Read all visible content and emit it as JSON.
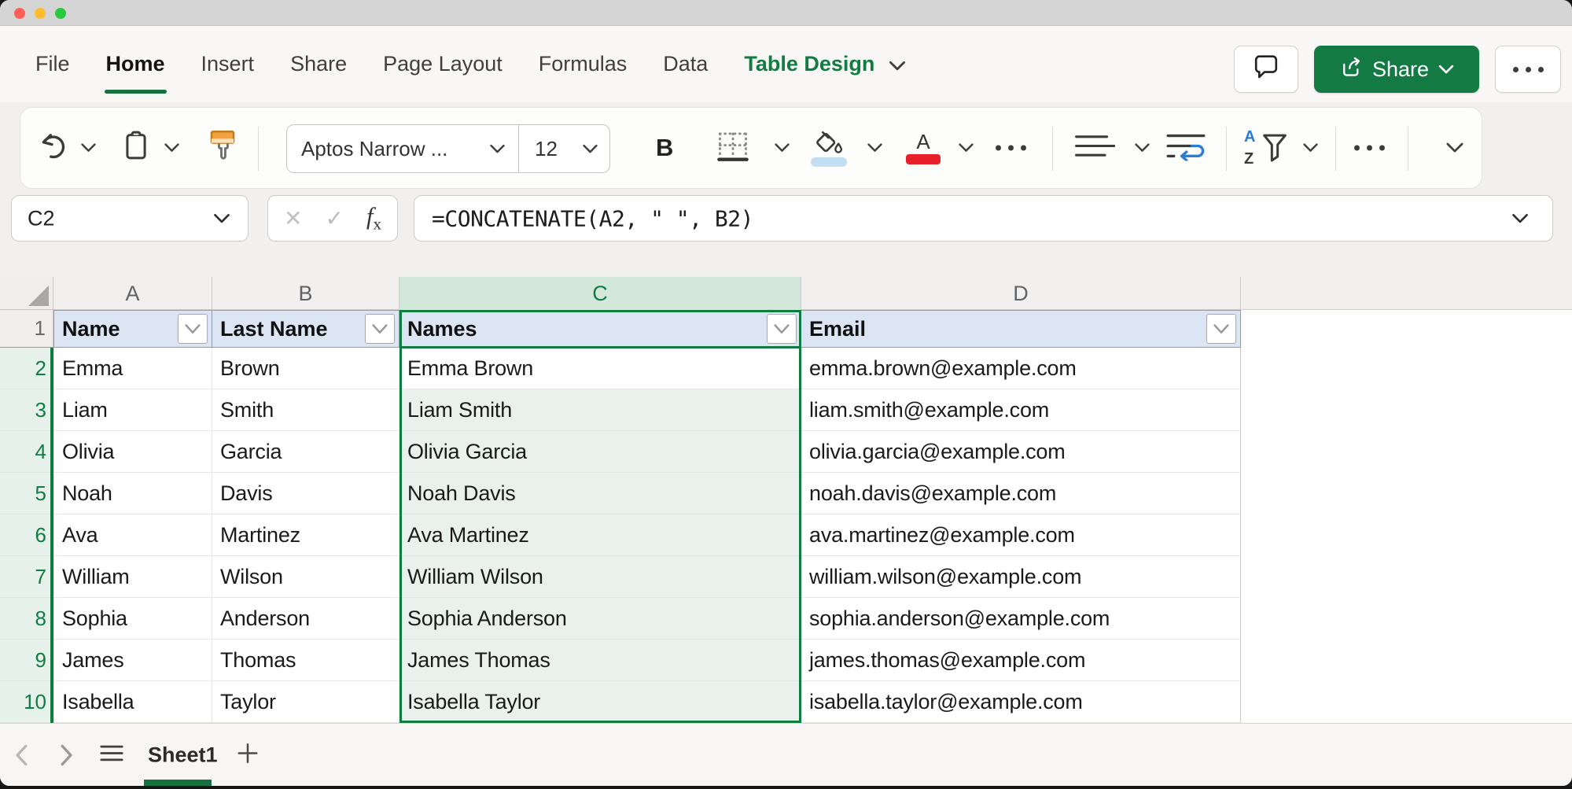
{
  "menu": {
    "items": [
      "File",
      "Home",
      "Insert",
      "Share",
      "Page Layout",
      "Formulas",
      "Data",
      "Table Design"
    ],
    "active": "Home",
    "contextual": "Table Design"
  },
  "top_actions": {
    "share_label": "Share"
  },
  "ribbon": {
    "font_name": "Aptos Narrow ...",
    "font_size": "12",
    "bold_label": "B",
    "sort_a": "A",
    "sort_z": "Z"
  },
  "formula_bar": {
    "name_box": "C2",
    "cancel_glyph": "✕",
    "enter_glyph": "✓",
    "fx_f": "f",
    "fx_x": "x",
    "formula": "=CONCATENATE(A2, \" \", B2)"
  },
  "grid": {
    "column_letters": [
      "A",
      "B",
      "C",
      "D"
    ],
    "selected_column": "C",
    "active_cell": "C2",
    "headers": [
      "Name",
      "Last Name",
      "Names",
      "Email"
    ],
    "rows": [
      {
        "n": "2",
        "cells": [
          "Emma",
          "Brown",
          "Emma Brown",
          "emma.brown@example.com"
        ]
      },
      {
        "n": "3",
        "cells": [
          "Liam",
          "Smith",
          "Liam Smith",
          "liam.smith@example.com"
        ]
      },
      {
        "n": "4",
        "cells": [
          "Olivia",
          "Garcia",
          "Olivia Garcia",
          "olivia.garcia@example.com"
        ]
      },
      {
        "n": "5",
        "cells": [
          "Noah",
          "Davis",
          "Noah Davis",
          "noah.davis@example.com"
        ]
      },
      {
        "n": "6",
        "cells": [
          "Ava",
          "Martinez",
          "Ava Martinez",
          "ava.martinez@example.com"
        ]
      },
      {
        "n": "7",
        "cells": [
          "William",
          "Wilson",
          "William Wilson",
          "william.wilson@example.com"
        ]
      },
      {
        "n": "8",
        "cells": [
          "Sophia",
          "Anderson",
          "Sophia Anderson",
          "sophia.anderson@example.com"
        ]
      },
      {
        "n": "9",
        "cells": [
          "James",
          "Thomas",
          "James Thomas",
          "james.thomas@example.com"
        ]
      },
      {
        "n": "10",
        "cells": [
          "Isabella",
          "Taylor",
          "Isabella Taylor",
          "isabella.taylor@example.com"
        ]
      }
    ],
    "row_1_number": "1"
  },
  "sheet_bar": {
    "tab_name": "Sheet1"
  },
  "colors": {
    "accent_green": "#107c41",
    "share_button": "#137a43",
    "header_fill": "#dbe5f4",
    "selection_tint": "#eaf1ec",
    "column_header_selected": "#d3e7db",
    "font_color_red": "#e8202a",
    "fill_bar_blue": "#c3ddf1",
    "wrap_arrow_blue": "#2b7cd3",
    "traffic_red": "#ff5f57",
    "traffic_yellow": "#febc2e",
    "traffic_green": "#28c840"
  }
}
